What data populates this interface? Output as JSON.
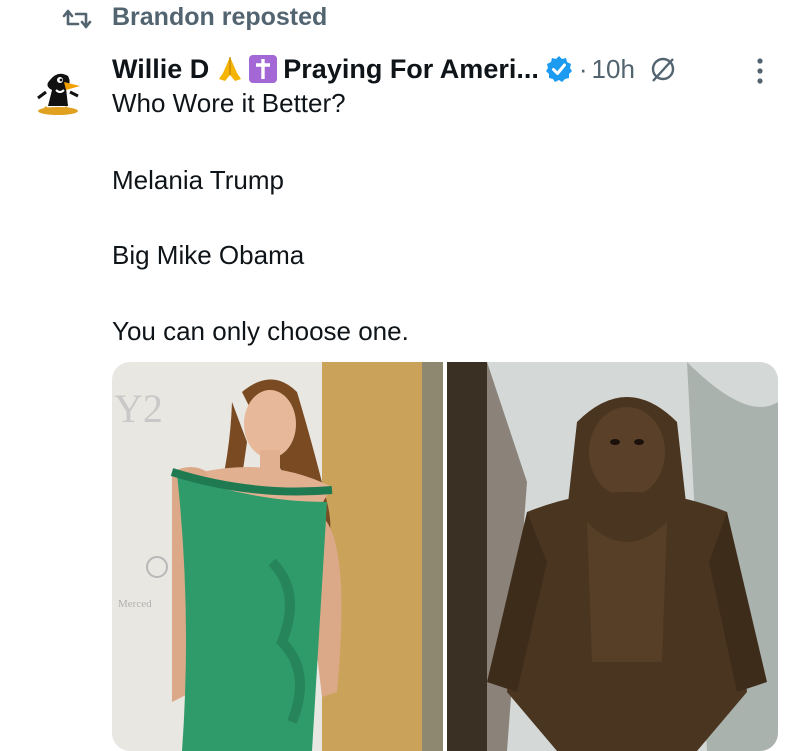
{
  "repost": {
    "label": "Brandon reposted",
    "icon": "repost-icon"
  },
  "tweet": {
    "author": {
      "name": "Willie D",
      "display_suffix": "Praying For Ameri...",
      "avatar": "daffy-duck-avatar",
      "verified": true
    },
    "meta": {
      "separator": "·",
      "time": "10h"
    },
    "lines": [
      "Who Wore it Better?",
      "Melania Trump",
      "Big Mike Obama",
      "You can only choose one."
    ]
  },
  "media": {
    "images": [
      {
        "subject": "woman-in-green-dress",
        "backdrop_text": "Y2",
        "sign_text": "Merced"
      },
      {
        "subject": "bigfoot-creature"
      }
    ]
  },
  "colors": {
    "verified": "#1d9bf0",
    "muted": "#536471",
    "text": "#0f1419",
    "dress": "#2f9a6a",
    "fur": "#4a3520"
  }
}
